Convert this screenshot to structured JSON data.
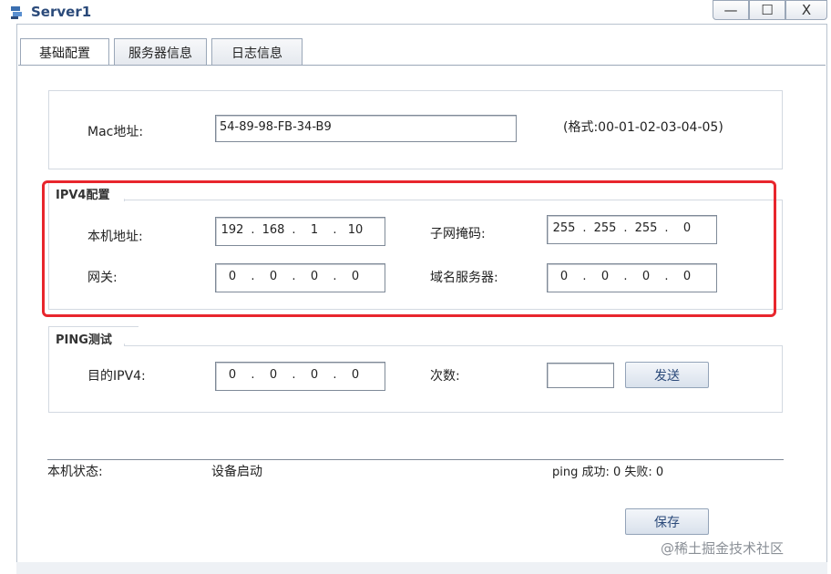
{
  "window": {
    "title": "Server1",
    "min_symbol": "—",
    "max_symbol": "☐",
    "close_symbol": "X"
  },
  "tabs": [
    "基础配置",
    "服务器信息",
    "日志信息"
  ],
  "mac": {
    "label": "Mac地址:",
    "value": "54-89-98-FB-34-B9",
    "format_hint": "(格式:00-01-02-03-04-05)"
  },
  "ipv4": {
    "section_title": "IPV4配置",
    "local_addr_label": "本机地址:",
    "local_addr": [
      "192",
      "168",
      "1",
      "10"
    ],
    "subnet_label": "子网掩码:",
    "subnet": [
      "255",
      "255",
      "255",
      "0"
    ],
    "gateway_label": "网关:",
    "gateway": [
      "0",
      "0",
      "0",
      "0"
    ],
    "dns_label": "域名服务器:",
    "dns": [
      "0",
      "0",
      "0",
      "0"
    ]
  },
  "ping": {
    "section_title": "PING测试",
    "target_label": "目的IPV4:",
    "target": [
      "0",
      "0",
      "0",
      "0"
    ],
    "count_label": "次数:",
    "count_value": "",
    "send_label": "发送"
  },
  "status": {
    "label": "本机状态:",
    "value": "设备启动",
    "ping_result": "ping 成功: 0 失败: 0"
  },
  "save_label": "保存",
  "watermark": "@稀土掘金技术社区",
  "colors": {
    "highlight": "#e8262d",
    "accent": "#2b4a7a"
  }
}
